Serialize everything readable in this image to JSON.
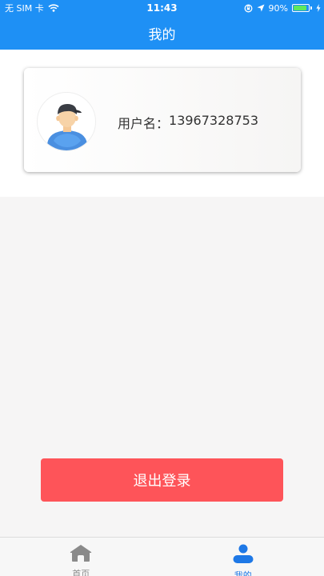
{
  "status_bar": {
    "carrier": "无 SIM 卡",
    "time": "11:43",
    "battery": "90%",
    "battery_level": 0.9,
    "battery_color": "#5ee85e"
  },
  "nav": {
    "title": "我的"
  },
  "profile": {
    "username_label": "用户名：",
    "username_value": "13967328753",
    "avatar_icon": "user-avatar-icon"
  },
  "actions": {
    "logout_label": "退出登录",
    "logout_color": "#fe5459"
  },
  "tabs": [
    {
      "label": "首页",
      "icon": "home-icon",
      "active": false
    },
    {
      "label": "我的",
      "icon": "person-icon",
      "active": true
    }
  ],
  "colors": {
    "brand": "#1e90f5",
    "active_tab": "#1e78e6",
    "inactive_tab": "#8a8a8a"
  }
}
